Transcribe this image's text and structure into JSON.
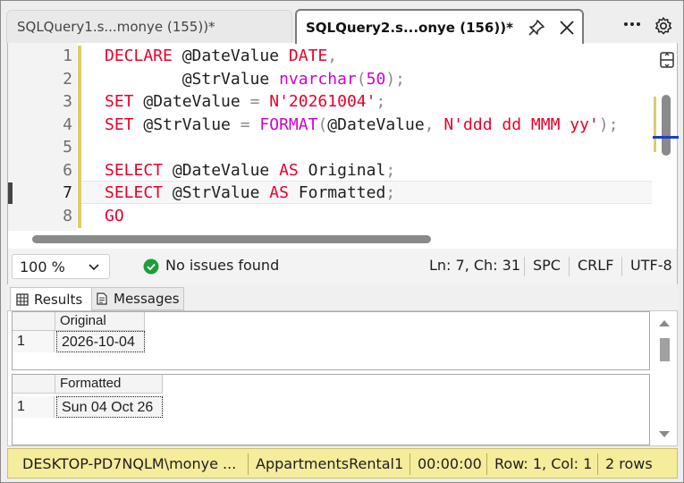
{
  "tabs": [
    {
      "label": "SQLQuery1.s...monye (155))*",
      "active": false
    },
    {
      "label": "SQLQuery2.s...onye (156))*",
      "active": true
    }
  ],
  "editor": {
    "line_numbers": [
      "1",
      "2",
      "3",
      "4",
      "5",
      "6",
      "7",
      "8"
    ],
    "current_line": 7,
    "lines": [
      [
        {
          "t": "kw",
          "v": "DECLARE"
        },
        {
          "t": "id",
          "v": " @DateValue "
        },
        {
          "t": "kw",
          "v": "DATE"
        },
        {
          "t": "pun",
          "v": ","
        }
      ],
      [
        {
          "t": "id",
          "v": "        @StrValue "
        },
        {
          "t": "fn",
          "v": "nvarchar"
        },
        {
          "t": "pun",
          "v": "("
        },
        {
          "t": "num",
          "v": "50"
        },
        {
          "t": "pun",
          "v": ");"
        }
      ],
      [
        {
          "t": "kw",
          "v": "SET"
        },
        {
          "t": "id",
          "v": " @DateValue "
        },
        {
          "t": "pun",
          "v": "= "
        },
        {
          "t": "str",
          "v": "N'20261004'"
        },
        {
          "t": "pun",
          "v": ";"
        }
      ],
      [
        {
          "t": "kw",
          "v": "SET"
        },
        {
          "t": "id",
          "v": " @StrValue "
        },
        {
          "t": "pun",
          "v": "= "
        },
        {
          "t": "fn",
          "v": "FORMAT"
        },
        {
          "t": "pun",
          "v": "("
        },
        {
          "t": "id",
          "v": "@DateValue"
        },
        {
          "t": "pun",
          "v": ", "
        },
        {
          "t": "str",
          "v": "N'ddd dd MMM yy'"
        },
        {
          "t": "pun",
          "v": ");"
        }
      ],
      [],
      [
        {
          "t": "kw",
          "v": "SELECT"
        },
        {
          "t": "id",
          "v": " @DateValue "
        },
        {
          "t": "kw",
          "v": "AS"
        },
        {
          "t": "id",
          "v": " Original"
        },
        {
          "t": "pun",
          "v": ";"
        }
      ],
      [
        {
          "t": "kw",
          "v": "SELECT"
        },
        {
          "t": "id",
          "v": " @StrValue "
        },
        {
          "t": "kw",
          "v": "AS"
        },
        {
          "t": "id",
          "v": " Formatted"
        },
        {
          "t": "pun",
          "v": ";"
        }
      ],
      [
        {
          "t": "kw",
          "v": "GO"
        }
      ]
    ]
  },
  "editor_status": {
    "zoom": "100 %",
    "issues": "No issues found",
    "position": "Ln: 7, Ch: 31",
    "whitespace": "SPC",
    "line_ending": "CRLF",
    "encoding": "UTF-8"
  },
  "results_tabs": {
    "results": "Results",
    "messages": "Messages"
  },
  "results": [
    {
      "column": "Original",
      "rows": [
        {
          "num": "1",
          "value": "2026-10-04"
        }
      ]
    },
    {
      "column": "Formatted",
      "rows": [
        {
          "num": "1",
          "value": "Sun 04 Oct 26"
        }
      ]
    }
  ],
  "connection_bar": {
    "server": "DESKTOP-PD7NQLM\\monye ...",
    "database": "AppartmentsRental1",
    "elapsed": "00:00:00",
    "row_col": "Row: 1, Col: 1",
    "rows": "2 rows"
  },
  "colors": {
    "keyword": "#e8002b",
    "function": "#d100d1",
    "status_bar": "#f5ec9c",
    "ok_green": "#1f9e3a"
  }
}
